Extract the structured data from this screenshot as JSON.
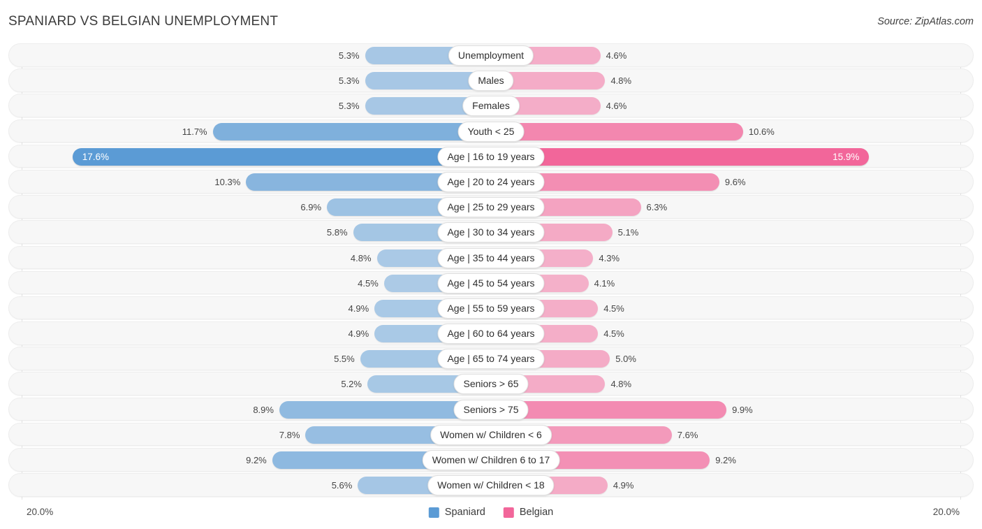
{
  "header": {
    "title": "SPANIARD VS BELGIAN UNEMPLOYMENT",
    "source": "Source: ZipAtlas.com"
  },
  "axis": {
    "left_label": "20.0%",
    "right_label": "20.0%"
  },
  "legend": {
    "items": [
      {
        "label": "Spaniard",
        "color": "#5B9BD5"
      },
      {
        "label": "Belgian",
        "color": "#F2669A"
      }
    ]
  },
  "colors": {
    "left_series": "#5B9BD5",
    "right_series": "#F2669A",
    "track": "#f7f7f7",
    "gridline": "#e3e3e3",
    "text": "#464646"
  },
  "chart_data": {
    "type": "bar",
    "title": "SPANIARD VS BELGIAN UNEMPLOYMENT",
    "subtitle": "",
    "xlabel": "",
    "ylabel": "",
    "orientation": "horizontal-diverging",
    "axis_max": 20.0,
    "units": "%",
    "legend_position": "bottom-center",
    "grid": true,
    "categories": [
      "Unemployment",
      "Males",
      "Females",
      "Youth < 25",
      "Age | 16 to 19 years",
      "Age | 20 to 24 years",
      "Age | 25 to 29 years",
      "Age | 30 to 34 years",
      "Age | 35 to 44 years",
      "Age | 45 to 54 years",
      "Age | 55 to 59 years",
      "Age | 60 to 64 years",
      "Age | 65 to 74 years",
      "Seniors > 65",
      "Seniors > 75",
      "Women w/ Children < 6",
      "Women w/ Children 6 to 17",
      "Women w/ Children < 18"
    ],
    "series": [
      {
        "name": "Spaniard",
        "color": "#5B9BD5",
        "values": [
          5.3,
          5.3,
          5.3,
          11.7,
          17.6,
          10.3,
          6.9,
          5.8,
          4.8,
          4.5,
          4.9,
          4.9,
          5.5,
          5.2,
          8.9,
          7.8,
          9.2,
          5.6
        ],
        "labels": [
          "5.3%",
          "5.3%",
          "5.3%",
          "11.7%",
          "17.6%",
          "10.3%",
          "6.9%",
          "5.8%",
          "4.8%",
          "4.5%",
          "4.9%",
          "4.9%",
          "5.5%",
          "5.2%",
          "8.9%",
          "7.8%",
          "9.2%",
          "5.6%"
        ]
      },
      {
        "name": "Belgian",
        "color": "#F2669A",
        "values": [
          4.6,
          4.8,
          4.6,
          10.6,
          15.9,
          9.6,
          6.3,
          5.1,
          4.3,
          4.1,
          4.5,
          4.5,
          5.0,
          4.8,
          9.9,
          7.6,
          9.2,
          4.9
        ],
        "labels": [
          "4.6%",
          "4.8%",
          "4.6%",
          "10.6%",
          "15.9%",
          "9.6%",
          "6.3%",
          "5.1%",
          "4.3%",
          "4.1%",
          "4.5%",
          "4.5%",
          "5.0%",
          "4.8%",
          "9.9%",
          "7.6%",
          "9.2%",
          "4.9%"
        ]
      }
    ]
  }
}
